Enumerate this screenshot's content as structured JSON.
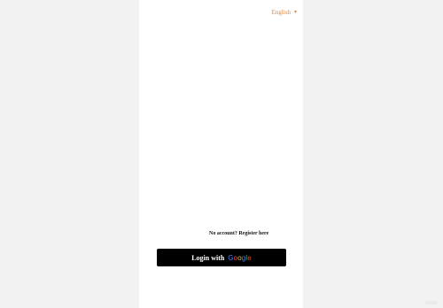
{
  "colors": {
    "background": "#f2f2f2",
    "panel": "#ffffff",
    "accent": "#e8833a",
    "button": "#000000"
  },
  "language": {
    "selected": "English",
    "icon": "chevron-down-icon"
  },
  "auth": {
    "register_prompt": "No account? Register here",
    "login_label": "Login with",
    "provider_letters": [
      "G",
      "o",
      "o",
      "g",
      "l",
      "e"
    ]
  }
}
